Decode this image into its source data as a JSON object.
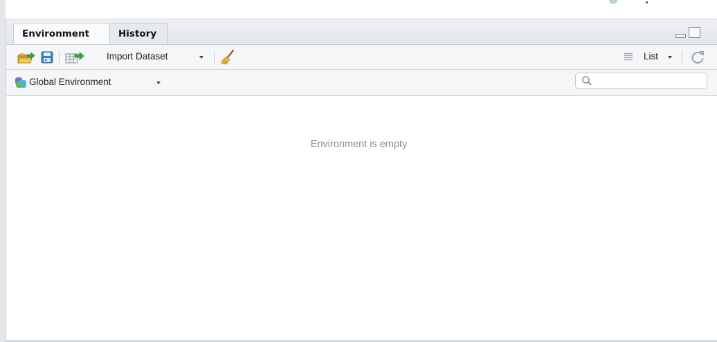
{
  "tabs": [
    {
      "label": "Environment",
      "active": true
    },
    {
      "label": "History",
      "active": false
    }
  ],
  "toolbar": {
    "load_icon": "open-folder-icon",
    "save_icon": "floppy-save-icon",
    "import_icon": "import-table-icon",
    "import_label": "Import Dataset",
    "clear_icon": "broom-icon",
    "view_label": "List",
    "view_icon": "list-lines-icon",
    "refresh_icon": "refresh-icon"
  },
  "env_bar": {
    "scope_label": "Global Environment",
    "scope_icon": "environment-cubes-icon",
    "search_icon": "search-icon",
    "search_value": ""
  },
  "content": {
    "empty_message": "Environment is empty"
  },
  "colors": {
    "tab_bar": "#e3e6ea",
    "toolbar": "#f5f6f8",
    "empty_text": "#8a8a8a"
  }
}
